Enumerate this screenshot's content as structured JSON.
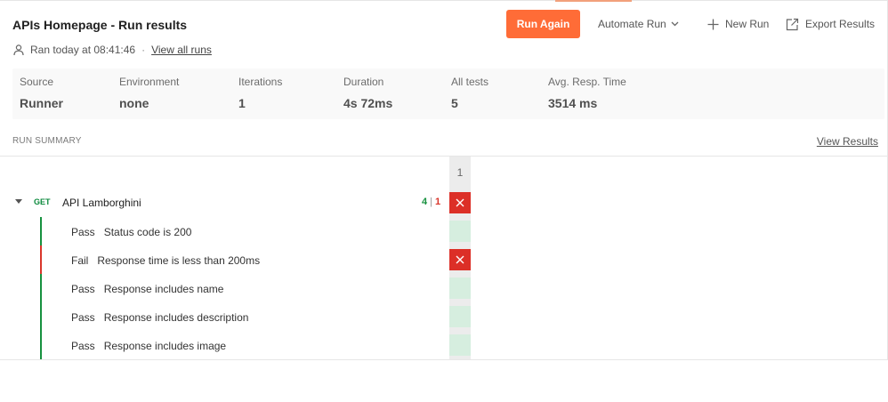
{
  "header": {
    "title": "APIs Homepage - Run results",
    "ran_text": "Ran today at 08:41:46",
    "separator": "·",
    "view_all_runs": "View all runs"
  },
  "toolbar": {
    "run_again": "Run Again",
    "automate_run": "Automate Run",
    "new_run": "New Run",
    "export_results": "Export Results"
  },
  "stats": [
    {
      "label": "Source",
      "value": "Runner"
    },
    {
      "label": "Environment",
      "value": "none"
    },
    {
      "label": "Iterations",
      "value": "1"
    },
    {
      "label": "Duration",
      "value": "4s 72ms"
    },
    {
      "label": "All tests",
      "value": "5"
    },
    {
      "label": "Avg. Resp. Time",
      "value": "3514 ms"
    }
  ],
  "summary": {
    "label": "RUN SUMMARY",
    "view_results": "View Results",
    "iteration_header": "1"
  },
  "request": {
    "method": "GET",
    "name": "API Lamborghini",
    "passed": "4",
    "divider": "|",
    "failed": "1",
    "result": "fail"
  },
  "tests": [
    {
      "status": "Pass",
      "name": "Status code is 200"
    },
    {
      "status": "Fail",
      "name": "Response time is less than 200ms"
    },
    {
      "status": "Pass",
      "name": "Response includes name"
    },
    {
      "status": "Pass",
      "name": "Response includes description"
    },
    {
      "status": "Pass",
      "name": "Response includes image"
    }
  ],
  "colors": {
    "accent": "#ff6c37",
    "pass": "#17913f",
    "fail": "#dc2f27",
    "pass_cell": "#d6eedf"
  }
}
